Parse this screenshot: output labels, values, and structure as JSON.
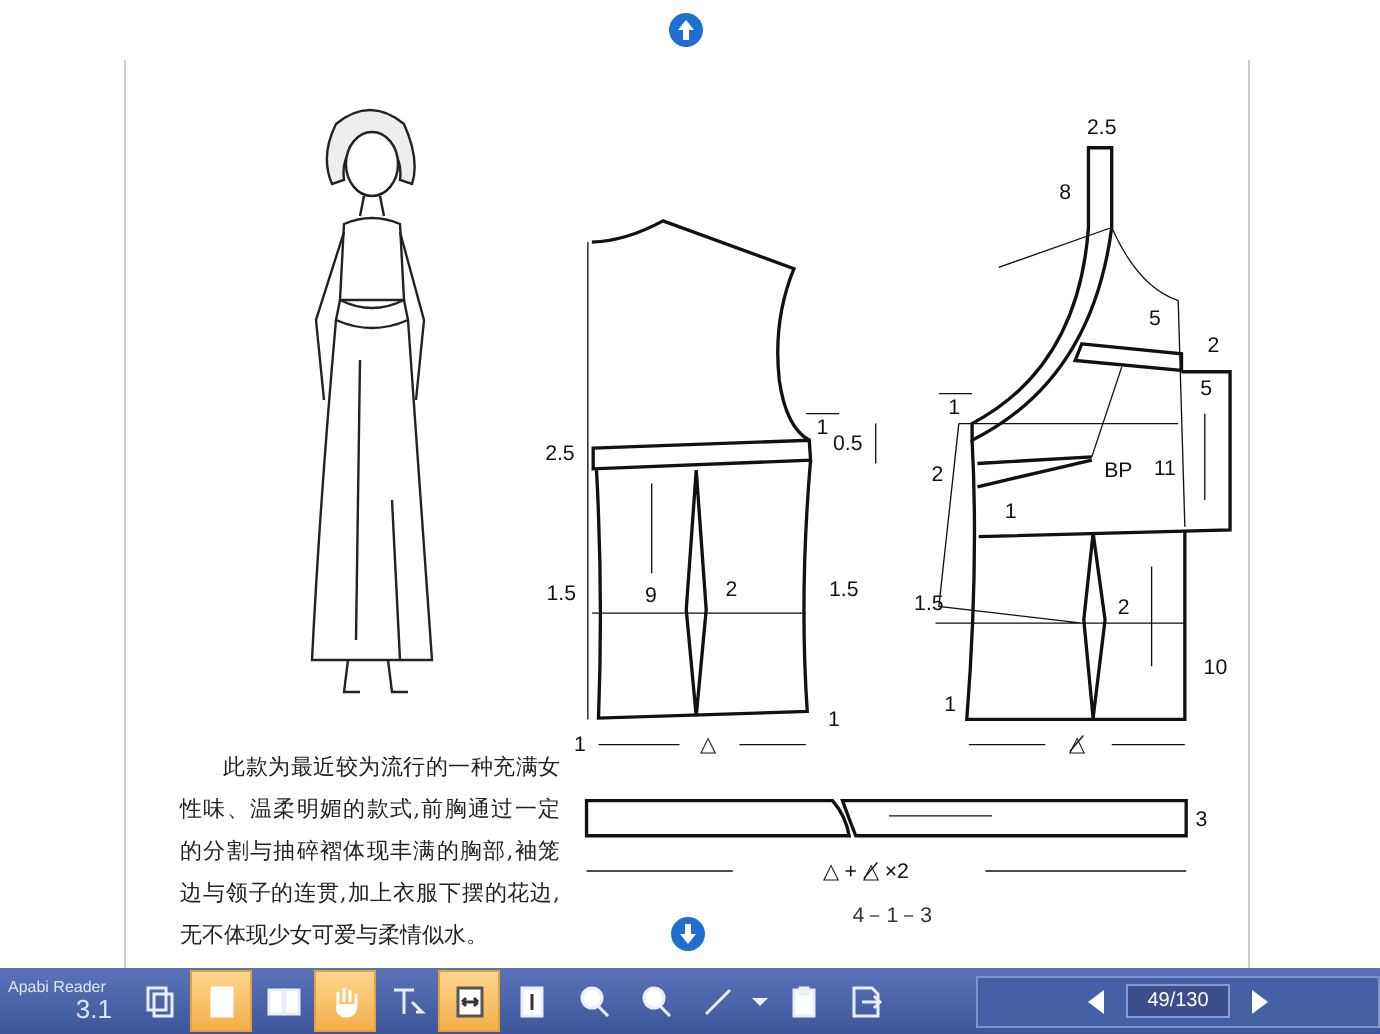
{
  "page": {
    "description": "此款为最近较为流行的一种充满女性味、温柔明媚的款式,前胸通过一定的分割与抽碎褶体现丰满的胸部,袖笼边与领子的连贯,加上衣服下摆的花边,无不体现少女可爱与柔情似水。",
    "front_labels": [
      "2.5",
      "1",
      "0.5",
      "1.5",
      "9",
      "2",
      "1.5",
      "1",
      "1"
    ],
    "back_labels": [
      "2.5",
      "8",
      "5",
      "2",
      "5",
      "1",
      "2",
      "BP",
      "11",
      "1",
      "1.5",
      "2",
      "10",
      "1"
    ],
    "dimension_labels": [
      "△",
      "△̸",
      "3",
      "△ + △̸ ×2"
    ],
    "figure_caption": "4－1－3"
  },
  "toolbar": {
    "app_name": "Apabi Reader",
    "version": "3.1",
    "tools": [
      {
        "kind": "copy",
        "selected": false
      },
      {
        "kind": "single-page",
        "selected": true
      },
      {
        "kind": "two-page",
        "selected": false
      },
      {
        "kind": "hand",
        "selected": true
      },
      {
        "kind": "text-select",
        "selected": false
      },
      {
        "kind": "fit-width",
        "selected": true
      },
      {
        "kind": "fit-height",
        "selected": false
      },
      {
        "kind": "zoom-in",
        "selected": false
      },
      {
        "kind": "zoom-out",
        "selected": false
      },
      {
        "kind": "pen",
        "selected": false
      },
      {
        "kind": "caret",
        "selected": false
      },
      {
        "kind": "clipboard",
        "selected": false
      },
      {
        "kind": "export",
        "selected": false
      }
    ],
    "page_indicator": "49/130"
  }
}
